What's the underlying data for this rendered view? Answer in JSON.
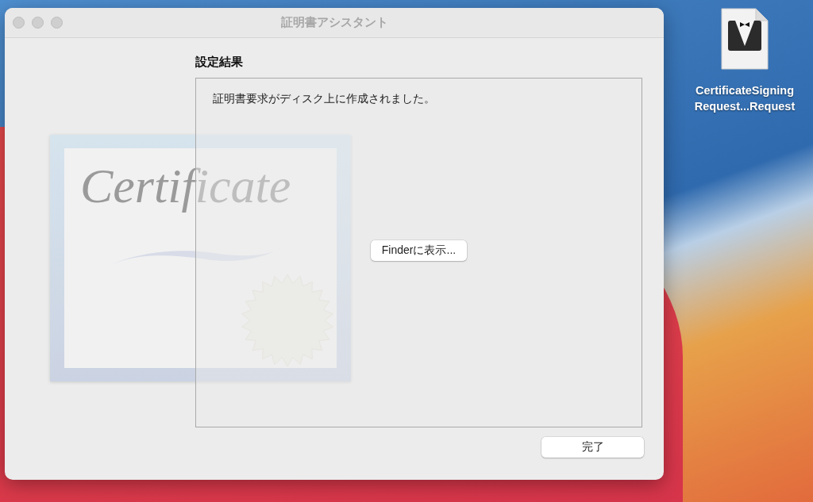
{
  "window": {
    "title": "証明書アシスタント"
  },
  "artwork": {
    "script_text": "Certificate"
  },
  "content": {
    "heading": "設定結果",
    "message": "証明書要求がディスク上に作成されました。",
    "buttons": [
      {
        "label": "Finderに表示..."
      }
    ]
  },
  "footer": {
    "buttons": [
      {
        "label": "完了"
      }
    ]
  },
  "desktop": {
    "file": {
      "name_lines": [
        "CertificateSigning",
        "Request...Request"
      ]
    }
  }
}
